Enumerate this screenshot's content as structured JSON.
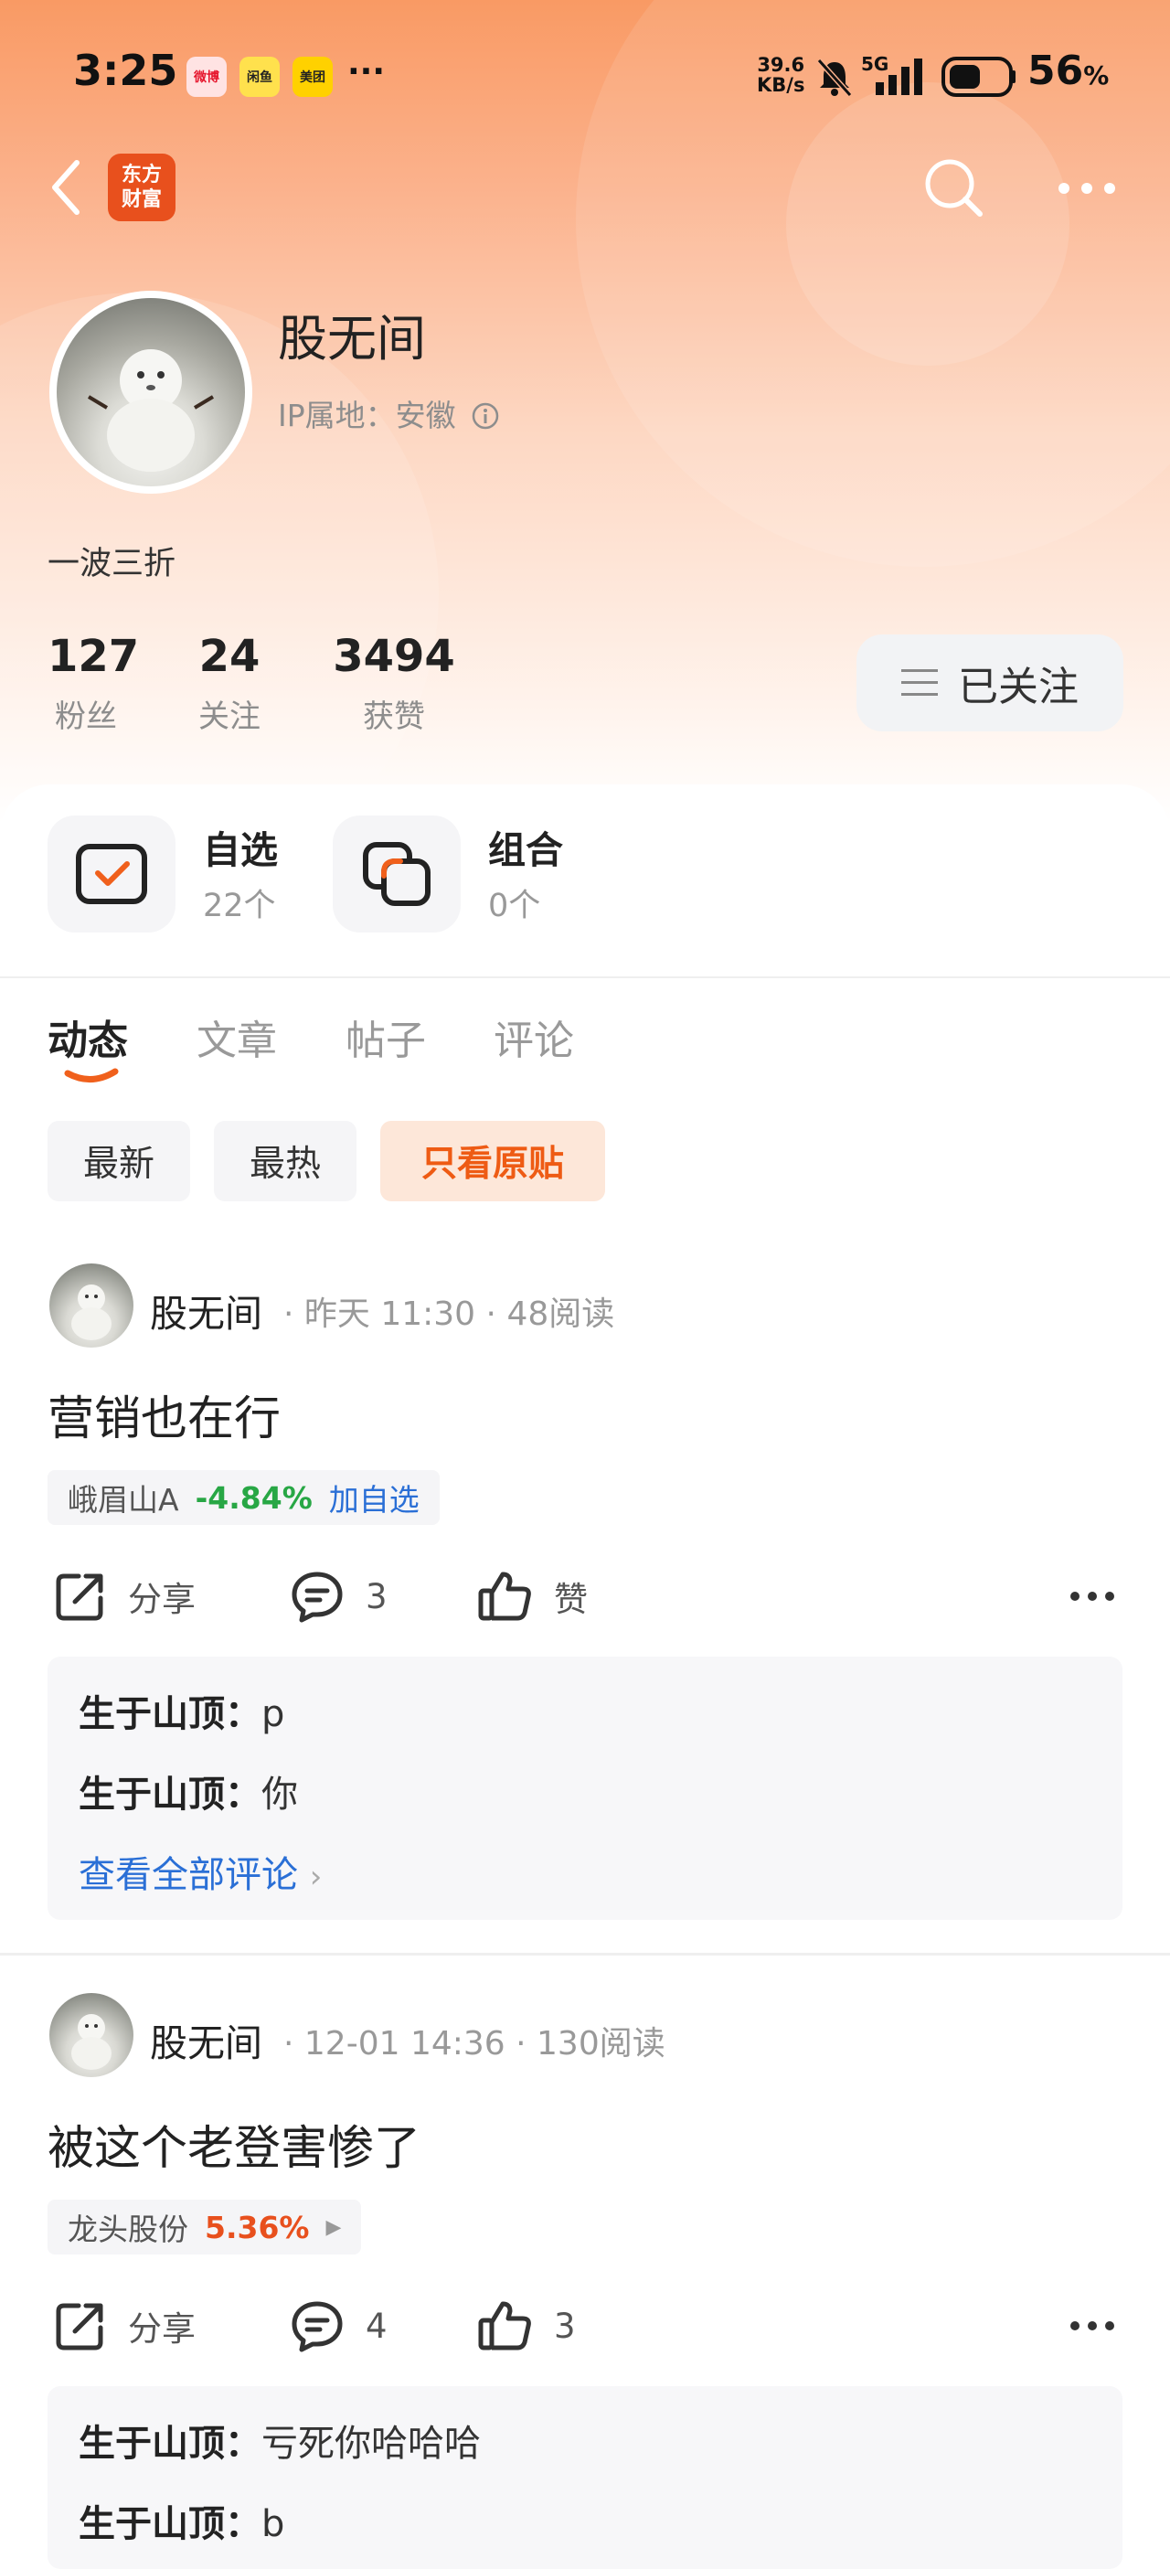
{
  "status_bar": {
    "time": "3:25",
    "apps": [
      "微博",
      "闲鱼",
      "美团"
    ],
    "more": "···",
    "speed_top": "39.6",
    "speed_unit": "KB/s",
    "network": "5G",
    "battery": "56",
    "battery_unit": "%"
  },
  "nav": {
    "brand_line1": "东方",
    "brand_line2": "财富"
  },
  "profile": {
    "name": "股无间",
    "ip_label": "IP属地：安徽",
    "bio": "一波三折",
    "stats": [
      {
        "value": "127",
        "label": "粉丝"
      },
      {
        "value": "24",
        "label": "关注"
      },
      {
        "value": "3494",
        "label": "获赞"
      }
    ],
    "follow_label": "已关注"
  },
  "quick_entries": [
    {
      "title": "自选",
      "sub": "22个"
    },
    {
      "title": "组合",
      "sub": "0个"
    }
  ],
  "tabs": [
    "动态",
    "文章",
    "帖子",
    "评论"
  ],
  "filters": [
    "最新",
    "最热",
    "只看原贴"
  ],
  "posts": [
    {
      "author": "股无间",
      "time": "昨天 11:30",
      "reads": "48阅读",
      "title": "营销也在行",
      "stock_name": "峨眉山A",
      "stock_change": "-4.84%",
      "stock_action": "加自选",
      "share_label": "分享",
      "comment_count": "3",
      "like_label": "赞",
      "comments": [
        {
          "user": "生于山顶：",
          "text": "p"
        },
        {
          "user": "生于山顶：",
          "text": "你"
        }
      ],
      "view_all": "查看全部评论"
    },
    {
      "author": "股无间",
      "time": "12-01 14:36",
      "reads": "130阅读",
      "title": "被这个老登害惨了",
      "stock_name": "龙头股份",
      "stock_change": "5.36%",
      "share_label": "分享",
      "comment_count": "4",
      "like_label": "3",
      "comments": [
        {
          "user": "生于山顶：",
          "text": "亏死你哈哈哈"
        },
        {
          "user": "生于山顶：",
          "text": "b"
        }
      ]
    }
  ],
  "colors": {
    "brand": "#e8501d",
    "accent": "#ee5b14",
    "down": "#28a745",
    "link": "#2a6fd6"
  }
}
